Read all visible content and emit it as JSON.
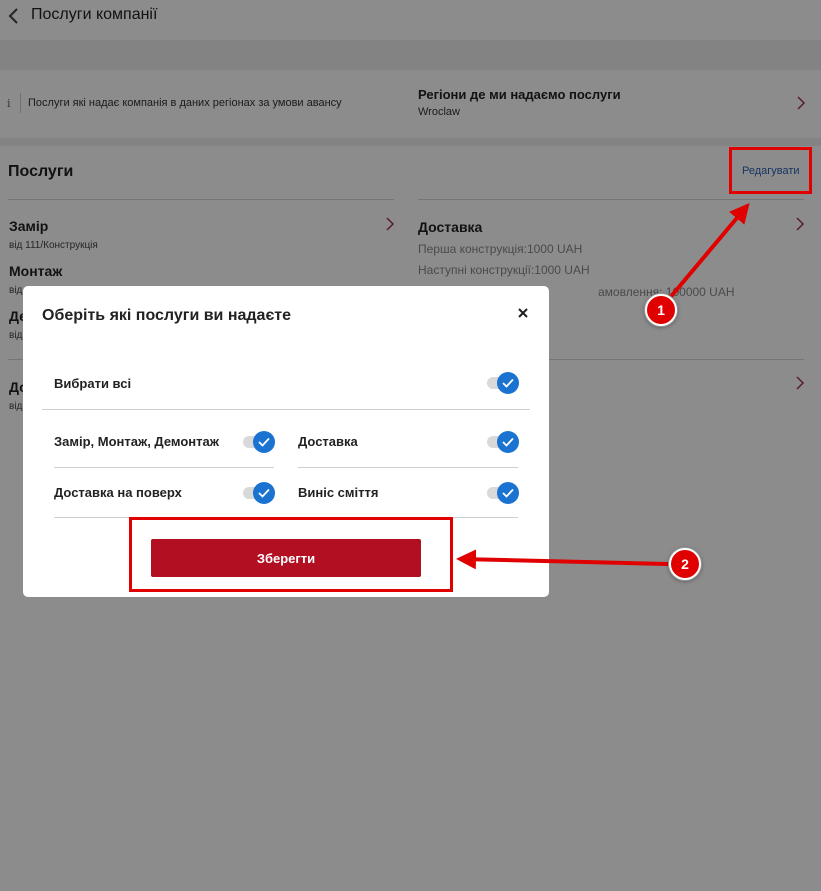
{
  "header": {
    "title": "Послуги компанії"
  },
  "info_row": {
    "info_text": "Послуги які надає компанія в даних регіонах за умови авансу",
    "regions_title": "Регіони де ми надаємо послуги",
    "regions_value": "Wroclaw"
  },
  "services": {
    "title": "Послуги",
    "edit_label": "Редагувати",
    "left": [
      {
        "name": "Замір",
        "sub": "від 111/Конструкція"
      },
      {
        "name": "Монтаж",
        "sub": "від"
      },
      {
        "name": "Де",
        "sub": "від"
      },
      {
        "name": "До",
        "sub": "від"
      }
    ],
    "delivery": {
      "name": "Доставка",
      "lines": [
        "Перша конструкція:1000 UAH",
        "Наступні конструкції:1000 UAH",
        "амовлення: 100000 UAH"
      ]
    }
  },
  "modal": {
    "title": "Оберіть які послуги ви надаєте",
    "select_all": "Вибрати всі",
    "options": [
      {
        "label": "Замір, Монтаж, Демонтаж",
        "checked": true
      },
      {
        "label": "Доставка",
        "checked": true
      },
      {
        "label": "Доставка на поверх",
        "checked": true
      },
      {
        "label": "Виніс сміття",
        "checked": true
      }
    ],
    "save_label": "Зберегти"
  },
  "annotations": {
    "badge1": "1",
    "badge2": "2",
    "color": "#e00000"
  },
  "colors": {
    "accent": "#b20f22",
    "toggle": "#1a73d0",
    "link": "#2b5fb3"
  }
}
